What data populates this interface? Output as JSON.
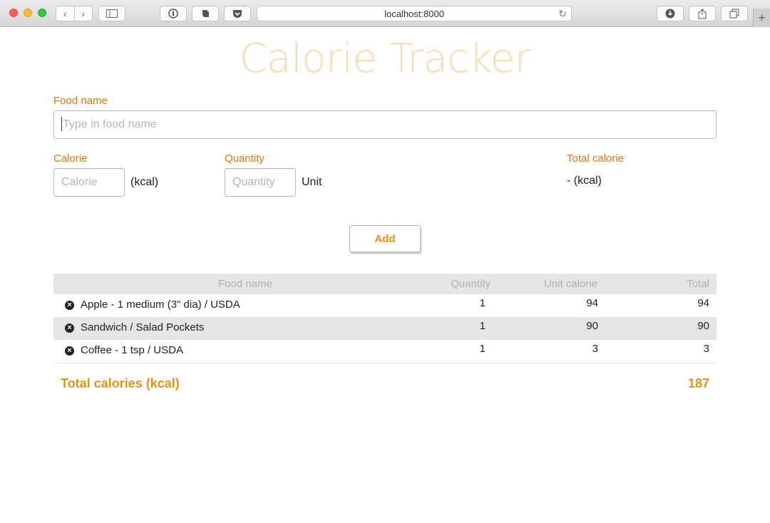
{
  "browser": {
    "url": "localhost:8000"
  },
  "app": {
    "title": "Calorie Tracker"
  },
  "form": {
    "food_name_label": "Food name",
    "food_name_placeholder": "Type in food name",
    "calorie_label": "Calorie",
    "calorie_placeholder": "Calorie",
    "calorie_unit": "(kcal)",
    "quantity_label": "Quantity",
    "quantity_placeholder": "Quantity",
    "quantity_unit": "Unit",
    "total_calorie_label": "Total calorie",
    "total_calorie_value": "- (kcal)",
    "add_label": "Add"
  },
  "table": {
    "headers": {
      "food_name": "Food name",
      "quantity": "Quantity",
      "unit_calorie": "Unit calorie",
      "total": "Total"
    },
    "rows": [
      {
        "food": "Apple - 1 medium (3\" dia) / USDA",
        "quantity": "1",
        "unit_calorie": "94",
        "total": "94"
      },
      {
        "food": "Sandwich / Salad Pockets",
        "quantity": "1",
        "unit_calorie": "90",
        "total": "90"
      },
      {
        "food": "Coffee - 1 tsp / USDA",
        "quantity": "1",
        "unit_calorie": "3",
        "total": "3"
      }
    ],
    "total_label": "Total calories (kcal)",
    "total_value": "187"
  },
  "colors": {
    "accent": "#e8730c",
    "button_text": "#f0900e",
    "title": "#fbdcb0"
  }
}
